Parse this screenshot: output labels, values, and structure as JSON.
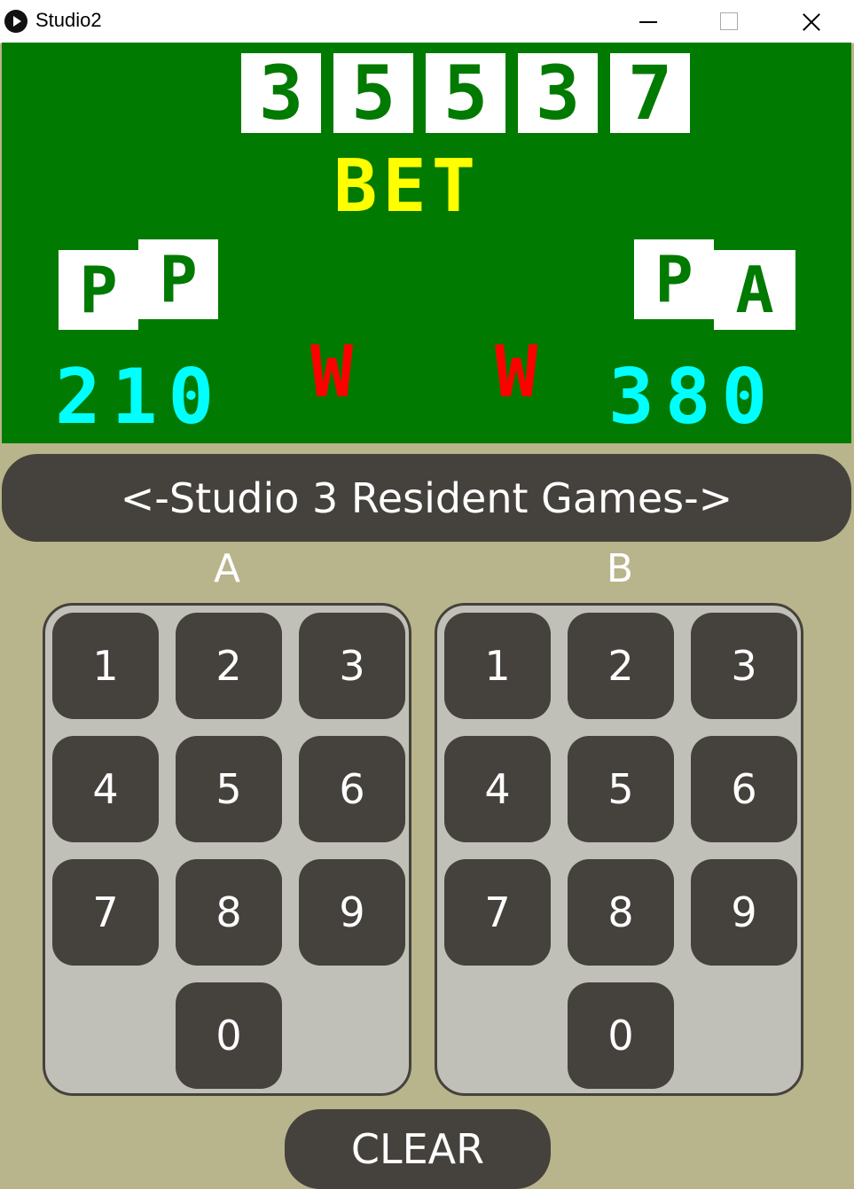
{
  "window": {
    "title": "Studio2"
  },
  "display": {
    "score_digits": [
      "3",
      "5",
      "5",
      "3",
      "7"
    ],
    "bet_label": "BET",
    "left_cards": [
      "P",
      "P"
    ],
    "right_cards": [
      "P",
      "A"
    ],
    "left_score": "210",
    "right_score": "380",
    "left_indicator": "W",
    "right_indicator": "W"
  },
  "games_button": {
    "label": "<-Studio 3 Resident Games->"
  },
  "pad_a": {
    "label": "A",
    "keys": [
      "1",
      "2",
      "3",
      "4",
      "5",
      "6",
      "7",
      "8",
      "9",
      "0"
    ]
  },
  "pad_b": {
    "label": "B",
    "keys": [
      "1",
      "2",
      "3",
      "4",
      "5",
      "6",
      "7",
      "8",
      "9",
      "0"
    ]
  },
  "clear_button": {
    "label": "CLEAR"
  }
}
